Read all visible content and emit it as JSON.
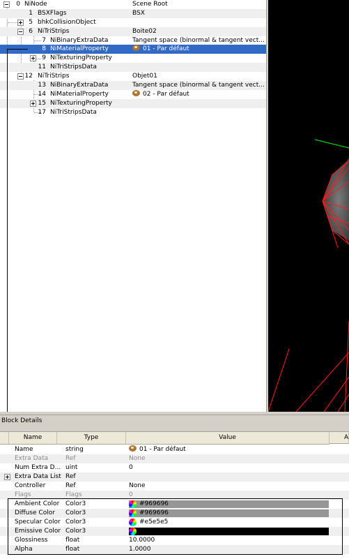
{
  "tree": {
    "rows": [
      {
        "num": "0",
        "name": "NiNode",
        "value": "Scene Root"
      },
      {
        "num": "1",
        "name": "BSXFlags",
        "value": "BSX"
      },
      {
        "num": "5",
        "name": "bhkCollisionObject",
        "value": ""
      },
      {
        "num": "6",
        "name": "NiTriStrips",
        "value": "Boite02"
      },
      {
        "num": "7",
        "name": "NiBinaryExtraData",
        "value": "Tangent space (binormal & tangent vect..."
      },
      {
        "num": "8",
        "name": "NiMaterialProperty",
        "value": "01 - Par défaut"
      },
      {
        "num": "9",
        "name": "NiTexturingProperty",
        "value": ""
      },
      {
        "num": "11",
        "name": "NiTriStripsData",
        "value": ""
      },
      {
        "num": "12",
        "name": "NiTriStrips",
        "value": "Objet01"
      },
      {
        "num": "13",
        "name": "NiBinaryExtraData",
        "value": "Tangent space (binormal & tangent vect..."
      },
      {
        "num": "14",
        "name": "NiMaterialProperty",
        "value": "02 - Par défaut"
      },
      {
        "num": "15",
        "name": "NiTexturingProperty",
        "value": ""
      },
      {
        "num": "17",
        "name": "NiTriStripsData",
        "value": ""
      }
    ]
  },
  "block_details": {
    "title": "Block Details",
    "columns": [
      "Name",
      "Type",
      "Value",
      "A"
    ],
    "rows": [
      {
        "name": "Name",
        "type": "string",
        "value": "01 - Par défaut"
      },
      {
        "name": "Extra Data",
        "type": "Ref",
        "value": "None"
      },
      {
        "name": "Num Extra D...",
        "type": "uint",
        "value": "0"
      },
      {
        "name": "Extra Data List",
        "type": "Ref",
        "value": ""
      },
      {
        "name": "Controller",
        "type": "Ref",
        "value": "None"
      },
      {
        "name": "Flags",
        "type": "Flags",
        "value": "0"
      },
      {
        "name": "Ambient Color",
        "type": "Color3",
        "value": "#969696",
        "color": "#969696"
      },
      {
        "name": "Diffuse Color",
        "type": "Color3",
        "value": "#969696",
        "color": "#969696"
      },
      {
        "name": "Specular Color",
        "type": "Color3",
        "value": "#e5e5e5",
        "color": "#ffffff"
      },
      {
        "name": "Emissive Color",
        "type": "Color3",
        "value": "",
        "color": "#000000"
      },
      {
        "name": "Glossiness",
        "type": "float",
        "value": "10.0000"
      },
      {
        "name": "Alpha",
        "type": "float",
        "value": "1.0000"
      }
    ]
  }
}
